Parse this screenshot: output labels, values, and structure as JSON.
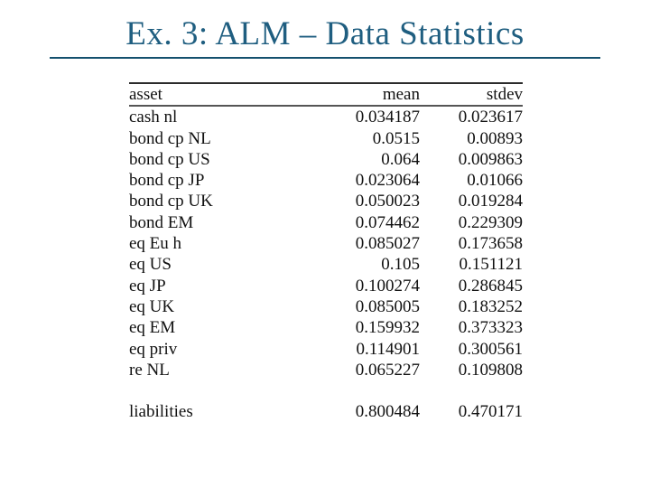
{
  "slide": {
    "title": "Ex. 3: ALM – Data Statistics",
    "title_color": "#1f5e80",
    "rule_color": "#14506e",
    "background": "#ffffff"
  },
  "table": {
    "headers": {
      "asset": "asset",
      "mean": "mean",
      "stdev": "stdev"
    },
    "rows": [
      {
        "asset": "cash nl",
        "mean": "0.034187",
        "stdev": "0.023617"
      },
      {
        "asset": "bond cp NL",
        "mean": "0.0515",
        "stdev": "0.00893"
      },
      {
        "asset": "bond cp US",
        "mean": "0.064",
        "stdev": "0.009863"
      },
      {
        "asset": "bond cp JP",
        "mean": "0.023064",
        "stdev": "0.01066"
      },
      {
        "asset": "bond cp UK",
        "mean": "0.050023",
        "stdev": "0.019284"
      },
      {
        "asset": "bond EM",
        "mean": "0.074462",
        "stdev": "0.229309"
      },
      {
        "asset": "eq Eu h",
        "mean": "0.085027",
        "stdev": "0.173658"
      },
      {
        "asset": "eq US",
        "mean": "0.105",
        "stdev": "0.151121"
      },
      {
        "asset": "eq JP",
        "mean": "0.100274",
        "stdev": "0.286845"
      },
      {
        "asset": "eq UK",
        "mean": "0.085005",
        "stdev": "0.183252"
      },
      {
        "asset": "eq EM",
        "mean": "0.159932",
        "stdev": "0.373323"
      },
      {
        "asset": "eq priv",
        "mean": "0.114901",
        "stdev": "0.300561"
      },
      {
        "asset": "re NL",
        "mean": "0.065227",
        "stdev": "0.109808"
      }
    ],
    "footer_rows": [
      {
        "asset": "liabilities",
        "mean": "0.800484",
        "stdev": "0.470171"
      }
    ]
  }
}
